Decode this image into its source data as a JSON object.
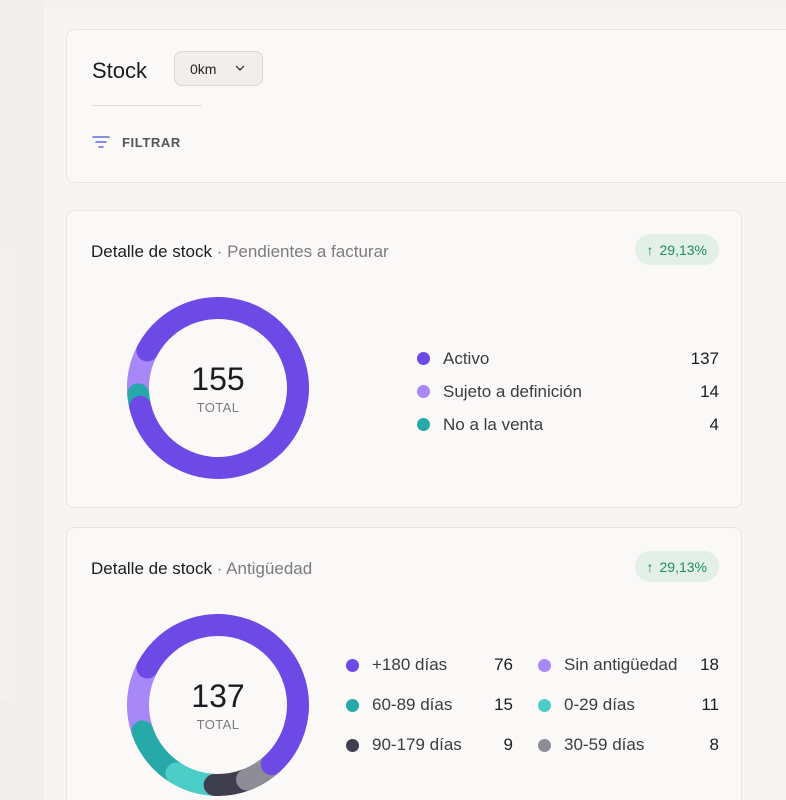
{
  "header": {
    "title": "Stock",
    "select_value": "0km",
    "filter_label": "FILTRAR"
  },
  "card_pending": {
    "title": "Detalle de stock",
    "separator": "·",
    "subtitle": "Pendientes a facturar",
    "trend": "29,13%",
    "total_value": "155",
    "total_label": "TOTAL",
    "legend": [
      {
        "label": "Activo",
        "value": "137",
        "color": "#6d4ae6"
      },
      {
        "label": "Sujeto a definición",
        "value": "14",
        "color": "#a888f7"
      },
      {
        "label": "No a la venta",
        "value": "4",
        "color": "#27a9a9"
      }
    ]
  },
  "card_age": {
    "title": "Detalle de stock",
    "separator": "·",
    "subtitle": "Antigüedad",
    "trend": "29,13%",
    "total_value": "137",
    "total_label": "TOTAL",
    "legend": [
      {
        "label": "+180 días",
        "value": "76",
        "color": "#6d4ae6"
      },
      {
        "label": "60-89 días",
        "value": "15",
        "color": "#27a9a9"
      },
      {
        "label": "90-179 días",
        "value": "9",
        "color": "#3f3e4e"
      },
      {
        "label": "Sin antigüedad",
        "value": "18",
        "color": "#a888f7"
      },
      {
        "label": "0-29 días",
        "value": "11",
        "color": "#4ccdc8"
      },
      {
        "label": "30-59 días",
        "value": "8",
        "color": "#8d8c97"
      }
    ]
  },
  "colors": {
    "accent": "#6d4ae6",
    "trend_bg": "#e3efe9",
    "trend_fg": "#1f8c5e"
  }
}
